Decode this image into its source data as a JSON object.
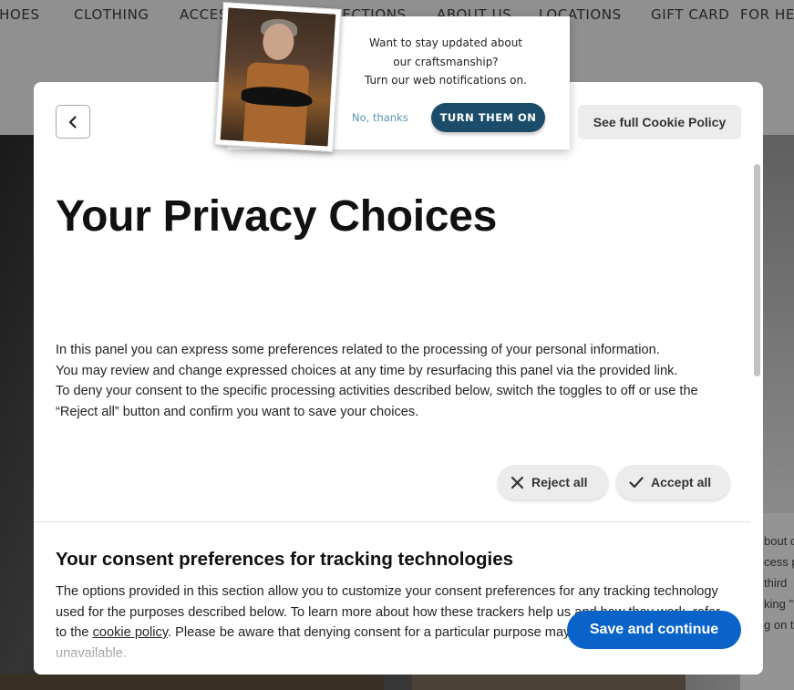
{
  "site_nav": {
    "items": [
      "SHOES",
      "CLOTHING",
      "ACCESSORIES",
      "COLLECTIONS",
      "ABOUT US",
      "LOCATIONS",
      "GIFT CARD",
      "FOR HER"
    ]
  },
  "background_snippets": [
    "bout o",
    "cess p",
    "third",
    "king \"",
    "g on th"
  ],
  "modal": {
    "back_icon": "chevron-left-icon",
    "cookie_policy_label": "See full Cookie Policy",
    "title": "Your Privacy Choices",
    "intro_lines": [
      "In this panel you can express some preferences related to the processing of your personal information.",
      "You may review and change expressed choices at any time by resurfacing this panel via the provided link.",
      "To deny your consent to the specific processing activities described below, switch the toggles to off or use the “Reject all” button and confirm you want to save your choices."
    ],
    "reject_label": "Reject all",
    "accept_label": "Accept all",
    "section_title": "Your consent preferences for tracking technologies",
    "section_body_before": "The options provided in this section allow you to customize your consent preferences for any tracking technology used for the purposes described below. To learn more about how these trackers help us and how they work, refer to the ",
    "section_link": "cookie policy",
    "section_body_after": ". Please be aware that denying consent for a particular purpose may make related features unavailable.",
    "save_label": "Save and continue",
    "accent_color": "#0a63c9"
  },
  "notification": {
    "line1": "Want to stay updated about",
    "line2": "our craftsmanship?",
    "line3": "Turn our web notifications on.",
    "dismiss_label": "No, thanks",
    "confirm_label": "TURN THEM ON",
    "confirm_color": "#1b4d6b"
  }
}
